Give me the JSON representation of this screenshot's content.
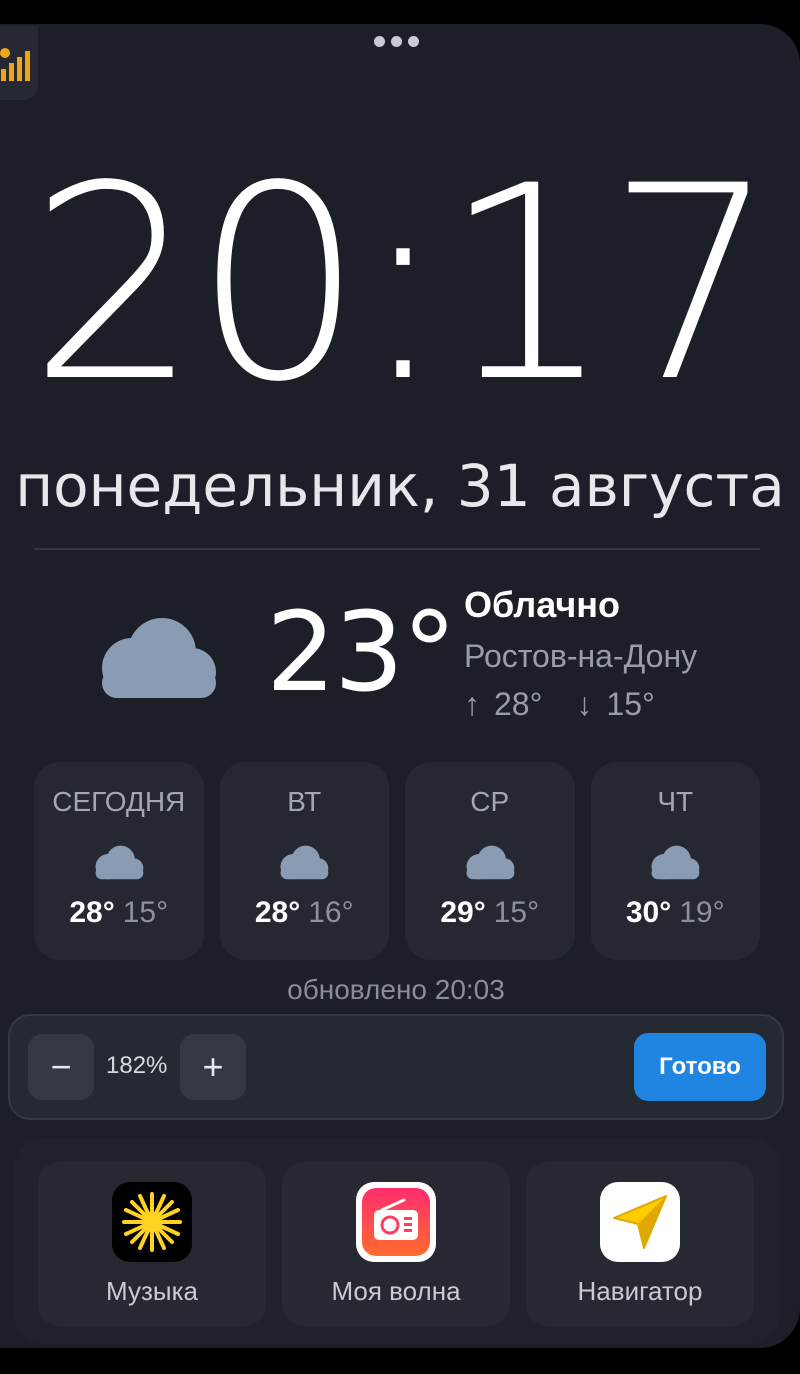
{
  "clock": {
    "time": "20:17",
    "date": "понедельник, 31 августа"
  },
  "weather": {
    "current_temp": "23°",
    "condition": "Облачно",
    "city": "Ростов-на-Дону",
    "high": "28°",
    "low": "15°",
    "high_arrow": "↑",
    "low_arrow": "↓",
    "forecast": [
      {
        "label": "СЕГОДНЯ",
        "hi": "28°",
        "lo": "15°",
        "icon": "cloud-icon"
      },
      {
        "label": "ВТ",
        "hi": "28°",
        "lo": "16°",
        "icon": "cloud-icon"
      },
      {
        "label": "СР",
        "hi": "29°",
        "lo": "15°",
        "icon": "cloud-icon"
      },
      {
        "label": "ЧТ",
        "hi": "30°",
        "lo": "19°",
        "icon": "cloud-icon"
      }
    ],
    "updated": "обновлено 20:03"
  },
  "zoom": {
    "minus": "−",
    "value": "182%",
    "plus": "+",
    "done": "Готово"
  },
  "dock": {
    "apps": [
      {
        "name": "Музыка",
        "icon": "music-star-icon"
      },
      {
        "name": "Моя волна",
        "icon": "radio-icon"
      },
      {
        "name": "Навигатор",
        "icon": "navigator-arrow-icon"
      }
    ]
  },
  "colors": {
    "accent": "#1f85e0",
    "cloud": "#8a9cb4",
    "background": "#1c1f27"
  }
}
